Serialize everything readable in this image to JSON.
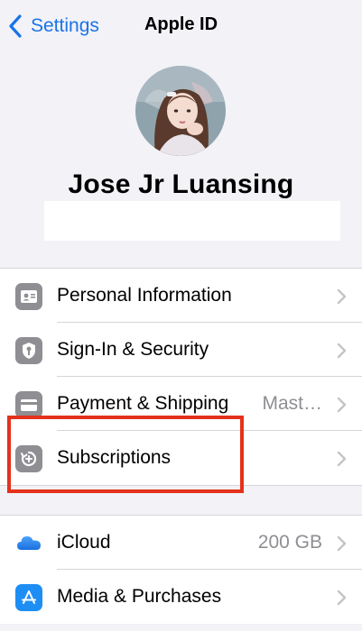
{
  "nav": {
    "back_label": "Settings",
    "title": "Apple ID"
  },
  "profile": {
    "name": "Jose Jr Luansing"
  },
  "group1": [
    {
      "label": "Personal Information",
      "icon": "person-card-icon",
      "value": ""
    },
    {
      "label": "Sign-In & Security",
      "icon": "key-shield-icon",
      "value": ""
    },
    {
      "label": "Payment & Shipping",
      "icon": "credit-card-icon",
      "value": "Mast…"
    },
    {
      "label": "Subscriptions",
      "icon": "subscriptions-icon",
      "value": ""
    }
  ],
  "group2": [
    {
      "label": "iCloud",
      "icon": "icloud-icon",
      "value": "200 GB"
    },
    {
      "label": "Media & Purchases",
      "icon": "app-store-icon",
      "value": ""
    }
  ],
  "colors": {
    "accent": "#1a73e8",
    "highlight": "#e5311c",
    "icon_gray": "#8e8e93"
  }
}
